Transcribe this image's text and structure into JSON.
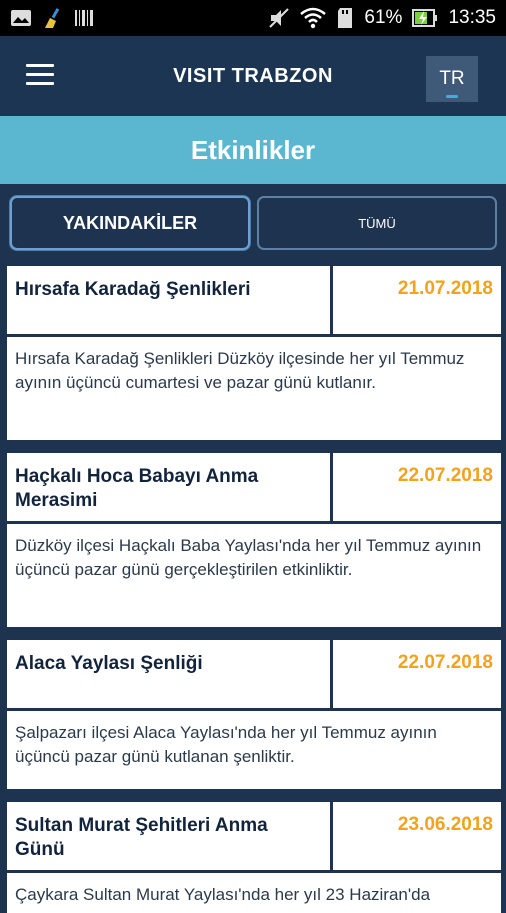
{
  "status_bar": {
    "battery": "61%",
    "time": "13:35",
    "icons": [
      "image-icon",
      "broom-icon",
      "barcode-icon",
      "mute-icon",
      "wifi-icon",
      "sd-card-icon",
      "battery-charging-icon"
    ]
  },
  "app": {
    "title": "VISIT TRABZON",
    "language": "TR"
  },
  "page": {
    "title": "Etkinlikler"
  },
  "tabs": [
    {
      "label": "YAKINDAKİLER",
      "active": true
    },
    {
      "label": "TÜMÜ",
      "active": false
    }
  ],
  "events": [
    {
      "title": "Hırsafa Karadağ Şenlikleri",
      "date": "21.07.2018",
      "description": "Hırsafa Karadağ Şenlikleri Düzköy ilçesinde her yıl Temmuz ayının üçüncü cumartesi ve pazar günü kutlanır."
    },
    {
      "title": "Haçkalı Hoca Babayı Anma Merasimi",
      "date": "22.07.2018",
      "description": "Düzköy ilçesi Haçkalı Baba Yaylası'nda her yıl Temmuz ayının üçüncü pazar günü gerçekleştirilen etkinliktir."
    },
    {
      "title": "Alaca Yaylası Şenliği",
      "date": "22.07.2018",
      "description": "Şalpazarı ilçesi Alaca Yaylası'nda her yıl Temmuz ayının üçüncü pazar günü kutlanan şenliktir."
    },
    {
      "title": "Sultan Murat Şehitleri Anma Günü",
      "date": "23.06.2018",
      "description": "Çaykara Sultan Murat Yaylası'nda her yıl 23 Haziran'da"
    }
  ],
  "colors": {
    "background": "#1d3350",
    "header_accent": "#5bb6d0",
    "date": "#f2a21c"
  }
}
